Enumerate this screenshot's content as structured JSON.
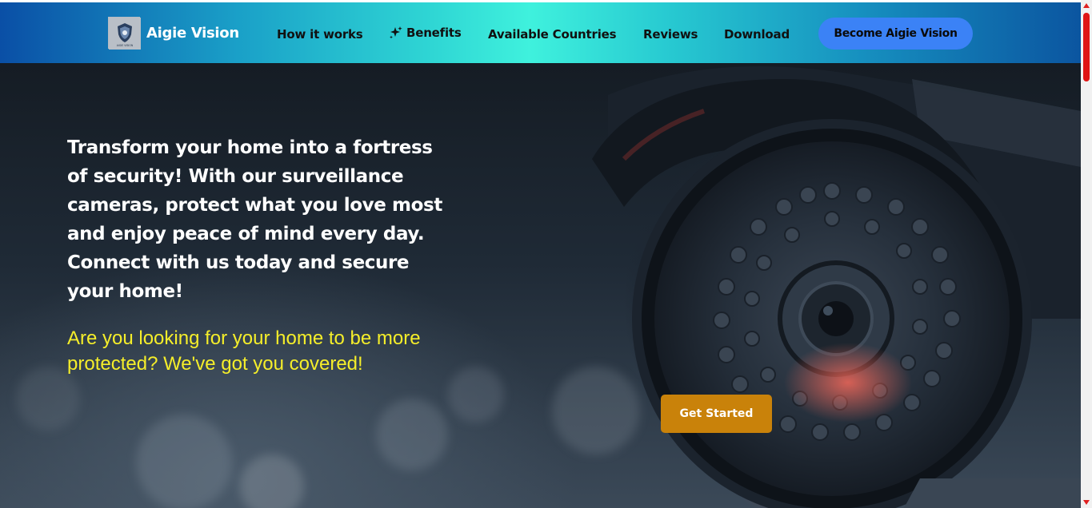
{
  "nav": {
    "brand": "Aigie Vision",
    "logo_text": "AIGIE VISION",
    "links": [
      "How it works",
      "Benefits",
      "Available Countries",
      "Reviews",
      "Download"
    ],
    "cta": "Become Aigie Vision"
  },
  "hero": {
    "heading": "Transform your home into a fortress of security! With our surveillance cameras, protect what you love most and enjoy peace of mind every day. Connect with us today and secure your home!",
    "subheading": "Are you looking for your home to be more protected? We've got you covered!",
    "button": "Get Started"
  },
  "icons": {
    "benefits": "sparkles-icon",
    "logo": "shield-logo-icon"
  },
  "colors": {
    "cta_button": "#3b82f6",
    "get_started": "#c9820a",
    "subheading": "#f5ee2a",
    "scrollbar_thumb": "#e01515"
  }
}
